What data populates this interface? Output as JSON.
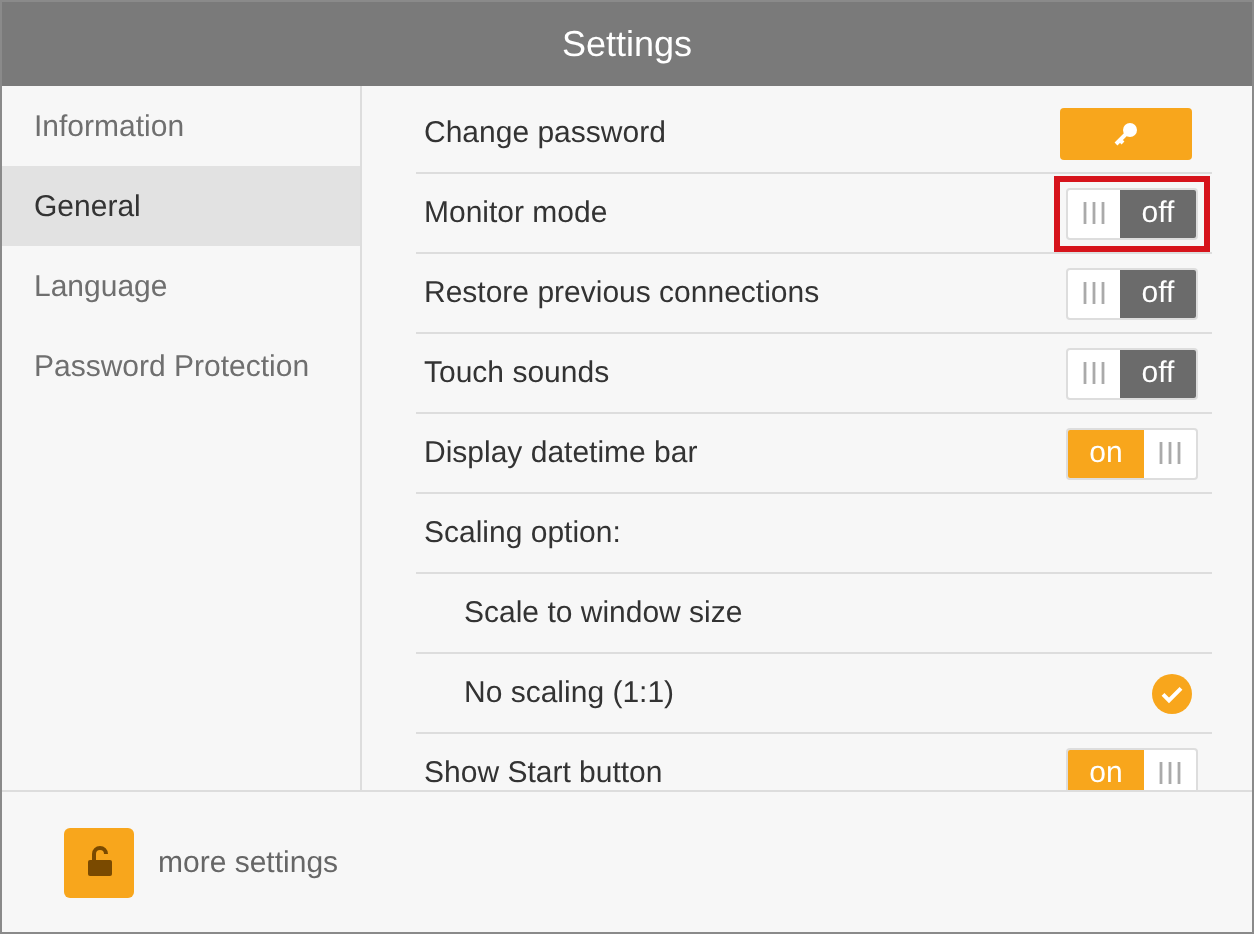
{
  "window": {
    "title": "Settings"
  },
  "sidebar": {
    "items": [
      {
        "label": "Information",
        "selected": false
      },
      {
        "label": "General",
        "selected": true
      },
      {
        "label": "Language",
        "selected": false
      },
      {
        "label": "Password Protection",
        "selected": false
      }
    ]
  },
  "settings": [
    {
      "kind": "button",
      "label": "Change password"
    },
    {
      "kind": "toggle",
      "label": "Monitor mode",
      "on": false,
      "state_text": "off",
      "highlighted": true
    },
    {
      "kind": "toggle",
      "label": "Restore previous connections",
      "on": false,
      "state_text": "off",
      "highlighted": false
    },
    {
      "kind": "toggle",
      "label": "Touch sounds",
      "on": false,
      "state_text": "off",
      "highlighted": false
    },
    {
      "kind": "toggle",
      "label": "Display datetime bar",
      "on": true,
      "state_text": "on",
      "highlighted": false
    },
    {
      "kind": "header",
      "label": "Scaling option:"
    },
    {
      "kind": "option",
      "label": "Scale to window size",
      "selected": false
    },
    {
      "kind": "option",
      "label": "No scaling (1:1)",
      "selected": true
    },
    {
      "kind": "toggle",
      "label": "Show Start button",
      "on": true,
      "state_text": "on",
      "highlighted": false
    }
  ],
  "footer": {
    "label": "more settings"
  }
}
